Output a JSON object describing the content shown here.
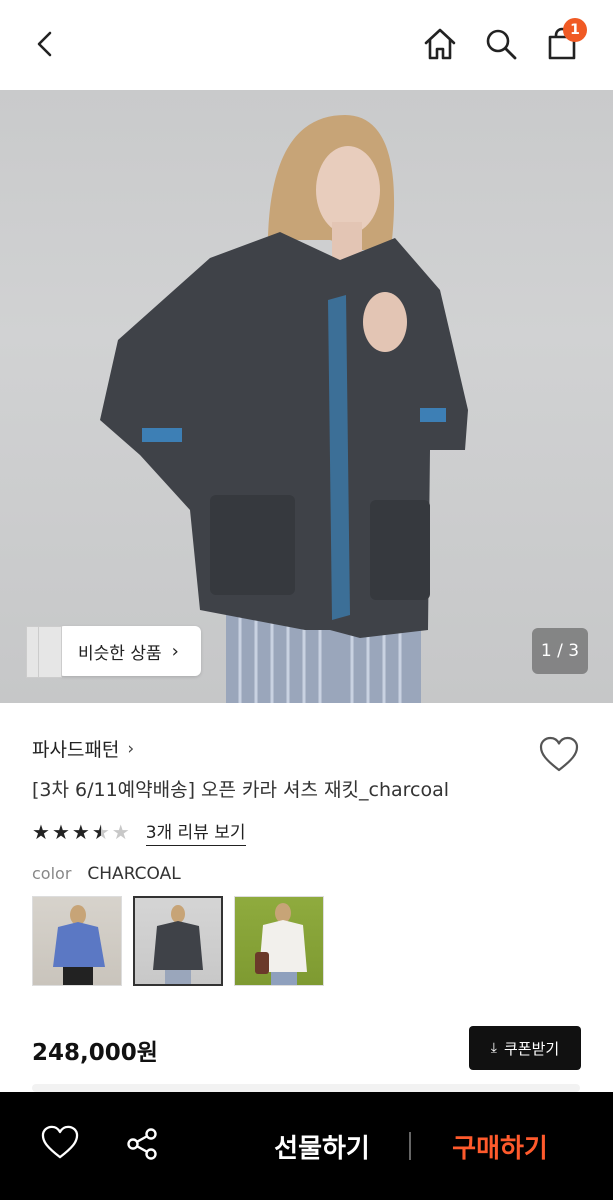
{
  "header": {
    "cart_count": "1",
    "icons": [
      "back-arrow-icon",
      "home-icon",
      "search-icon",
      "shopping-bag-icon"
    ]
  },
  "hero": {
    "similar_label": "비슷한 상품",
    "counter": "1 / 3"
  },
  "product": {
    "brand": "파사드패턴",
    "title": "[3차 6/11예약배송] 오픈 카라 셔츠 재킷_charcoal",
    "rating": 3.5,
    "review_link": "3개 리뷰 보기",
    "color_label": "color",
    "color_value": "CHARCOAL",
    "swatch_selected_index": 1,
    "price": "248,000원",
    "coupon_label": "쿠폰받기"
  },
  "bottom_bar": {
    "gift_label": "선물하기",
    "buy_label": "구매하기",
    "icons": [
      "heart-icon",
      "share-icon"
    ]
  },
  "colors": {
    "badge": "#f05a24",
    "buy": "#ff5a2c",
    "bottom_bar_bg": "#000000"
  }
}
